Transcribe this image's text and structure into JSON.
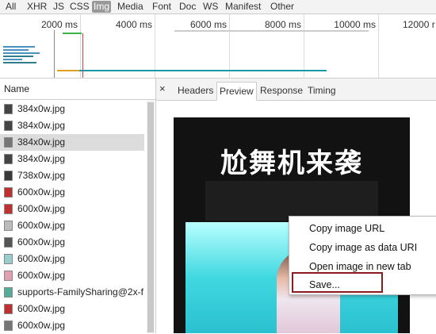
{
  "filters": [
    "All",
    "XHR",
    "JS",
    "CSS",
    "Img",
    "Media",
    "Font",
    "Doc",
    "WS",
    "Manifest",
    "Other"
  ],
  "active_filter": "Img",
  "timeline": {
    "ticks": [
      "2000 ms",
      "4000 ms",
      "6000 ms",
      "8000 ms",
      "10000 ms",
      "12000 r"
    ]
  },
  "names_panel": {
    "header": "Name",
    "rows": [
      "384x0w.jpg",
      "384x0w.jpg",
      "384x0w.jpg",
      "384x0w.jpg",
      "738x0w.jpg",
      "600x0w.jpg",
      "600x0w.jpg",
      "600x0w.jpg",
      "600x0w.jpg",
      "600x0w.jpg",
      "600x0w.jpg",
      "supports-FamilySharing@2x-f.",
      "600x0w.jpg",
      "600x0w.jpg"
    ],
    "selected_index": 2
  },
  "detail": {
    "close": "×",
    "tabs": [
      "Headers",
      "Preview",
      "Response",
      "Timing"
    ],
    "active_tab": "Preview"
  },
  "preview": {
    "poster_title": "尬舞机来袭"
  },
  "context_menu": {
    "items": [
      "Copy image URL",
      "Copy image as data URI",
      "Open image in new tab",
      "Save..."
    ],
    "highlighted": "Save..."
  }
}
